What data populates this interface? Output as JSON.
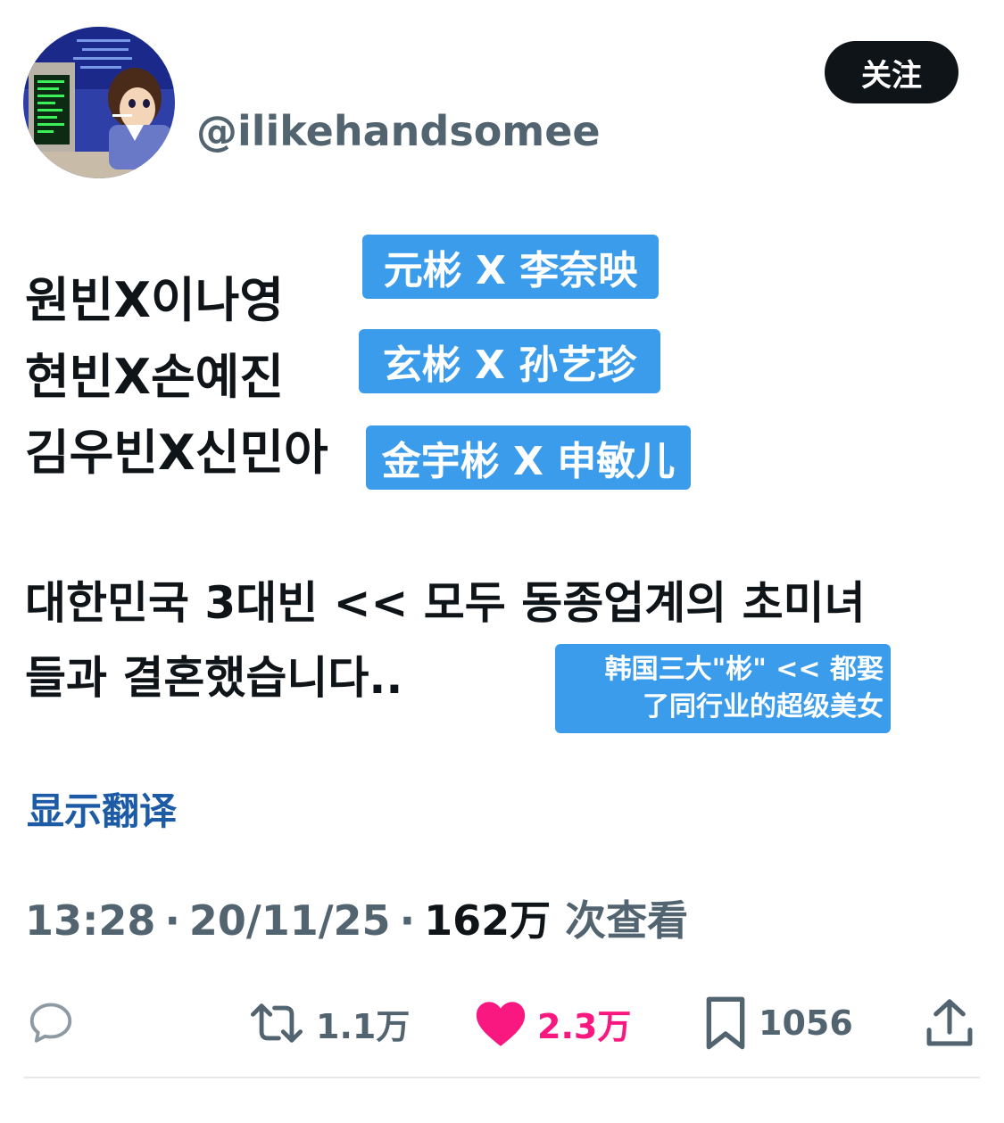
{
  "tweet": {
    "username": "@ilikehandsomee",
    "follow_label": "关注",
    "lines": [
      {
        "korean": "원빈X이나영",
        "note": "元彬 X 李奈映"
      },
      {
        "korean": "현빈X손예진",
        "note": "玄彬 X 孙艺珍"
      },
      {
        "korean": "김우빈X신민아",
        "note": "金宇彬 X 申敏儿"
      }
    ],
    "paragraph_line1": "대한민국 3대빈 << 모두 동종업계의 초미녀",
    "paragraph_line2": "들과 결혼했습니다..",
    "paragraph_note_line1": "韩国三大\"彬\" << 都娶",
    "paragraph_note_line2": "了同行业的超级美女",
    "show_translation": "显示翻译",
    "time": "13:28",
    "date": "20/11/25",
    "views_number": "162万",
    "views_label": "次查看",
    "separator": "·"
  },
  "actions": {
    "reply_count": "",
    "retweet_count": "1.1万",
    "like_count": "2.3万",
    "bookmark_count": "1056"
  },
  "colors": {
    "like": "#f91880",
    "note_bg": "#3b9cec",
    "muted": "#536471",
    "link": "#1d5ba6"
  }
}
